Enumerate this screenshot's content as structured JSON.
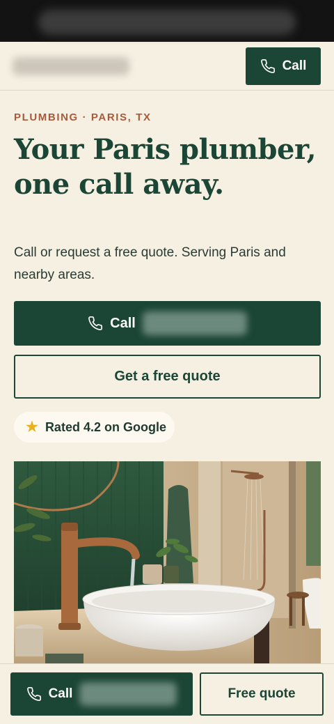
{
  "header": {
    "call_label": "Call"
  },
  "hero": {
    "eyebrow": "PLUMBING · PARIS, TX",
    "title": "Your Paris plumber, one call away.",
    "subtitle": "Call or request a free quote. Serving Paris and nearby areas.",
    "call_label": "Call",
    "quote_label": "Get a free quote",
    "rating_text": "Rated 4.2 on Google"
  },
  "bottom_bar": {
    "call_label": "Call",
    "quote_label": "Free quote"
  },
  "icons": {
    "phone": "phone-icon",
    "star": "star-icon"
  },
  "colors": {
    "primary": "#1b4535",
    "accent": "#a65b3a",
    "background": "#f6f0e3",
    "star": "#e8b21e"
  }
}
